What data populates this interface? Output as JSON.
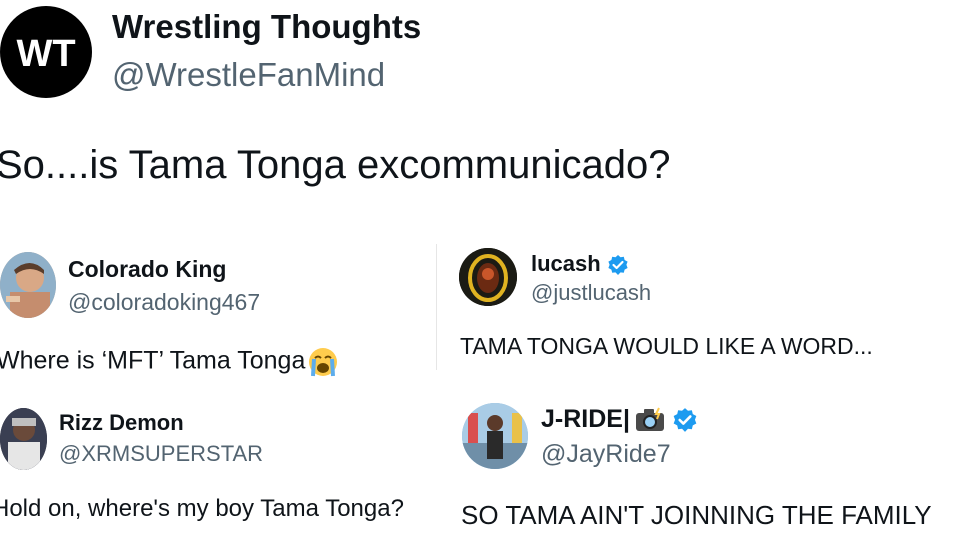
{
  "header": {
    "logo_text": "WT",
    "account_name": "Wrestling Thoughts",
    "account_handle": "@WrestleFanMind",
    "post_text": "So....is Tama Tonga excommunicado?"
  },
  "replies": [
    {
      "name": "Colorado King",
      "handle": "@coloradoking467",
      "text": "Where is ‘MFT’ Tama Tonga",
      "emoji": "loudly-crying-face-emoji",
      "verified": false
    },
    {
      "name": "lucash",
      "handle": "@justlucash",
      "text": "TAMA TONGA WOULD LIKE A WORD...",
      "verified": true
    },
    {
      "name": "Rizz Demon",
      "handle": "@XRMSUPERSTAR",
      "text": "Hold on, where's my boy Tama Tonga?",
      "verified": false
    },
    {
      "name": "J-RIDE|",
      "name_emoji": "camera-with-flash-emoji",
      "handle": "@JayRide7",
      "text": "SO TAMA AIN'T JOINNING THE FAMILY",
      "verified": true
    }
  ],
  "colors": {
    "text": "#0f1419",
    "handle": "#536471",
    "verified_blue": "#1d9bf0",
    "logo_bg": "#000000"
  }
}
